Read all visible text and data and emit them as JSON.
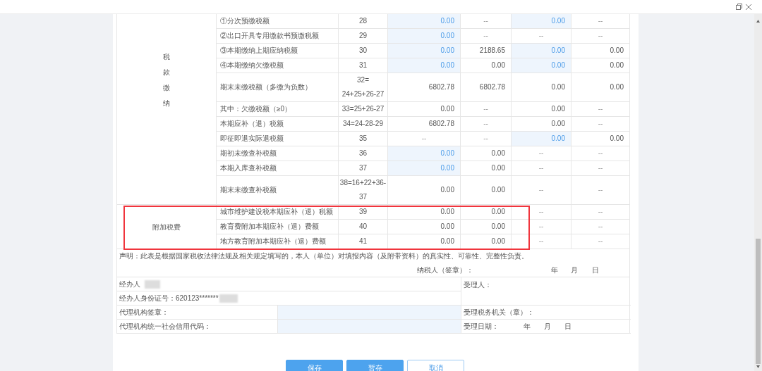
{
  "tax_payment": {
    "group": "税款缴纳",
    "rows": [
      {
        "item": "①分次预缴税额",
        "line": "28",
        "cells": [
          {
            "kind": "input",
            "text": "0.00"
          },
          {
            "kind": "blank",
            "text": "--"
          },
          {
            "kind": "input",
            "text": "0.00"
          },
          {
            "kind": "blank",
            "text": "--"
          }
        ]
      },
      {
        "item": "②出口开具专用缴款书预缴税额",
        "line": "29",
        "cells": [
          {
            "kind": "input",
            "text": "0.00"
          },
          {
            "kind": "blank",
            "text": "--"
          },
          {
            "kind": "blank",
            "text": "--"
          },
          {
            "kind": "blank",
            "text": "--"
          }
        ]
      },
      {
        "item": "③本期缴纳上期应纳税额",
        "line": "30",
        "cells": [
          {
            "kind": "input",
            "text": "0.00"
          },
          {
            "kind": "value",
            "text": "2188.65"
          },
          {
            "kind": "input",
            "text": "0.00"
          },
          {
            "kind": "value",
            "text": "0.00"
          }
        ]
      },
      {
        "item": "④本期缴纳欠缴税额",
        "line": "31",
        "cells": [
          {
            "kind": "input",
            "text": "0.00"
          },
          {
            "kind": "value",
            "text": "0.00"
          },
          {
            "kind": "input",
            "text": "0.00"
          },
          {
            "kind": "value",
            "text": "0.00"
          }
        ]
      },
      {
        "item": "期末未缴税额（多缴为负数）",
        "line": "32= 24+25+26-27",
        "cells": [
          {
            "kind": "value",
            "text": "6802.78"
          },
          {
            "kind": "value",
            "text": "6802.78"
          },
          {
            "kind": "value",
            "text": "0.00"
          },
          {
            "kind": "value",
            "text": "0.00"
          }
        ]
      },
      {
        "item": "其中：欠缴税额（≥0）",
        "line": "33=25+26-27",
        "cells": [
          {
            "kind": "value",
            "text": "0.00"
          },
          {
            "kind": "blank",
            "text": "--"
          },
          {
            "kind": "value",
            "text": "0.00"
          },
          {
            "kind": "blank",
            "text": "--"
          }
        ]
      },
      {
        "item": "本期应补（退）税额",
        "line": "34=24-28-29",
        "cells": [
          {
            "kind": "value",
            "text": "6802.78"
          },
          {
            "kind": "blank",
            "text": "--"
          },
          {
            "kind": "value",
            "text": "0.00"
          },
          {
            "kind": "blank",
            "text": "--"
          }
        ]
      },
      {
        "item": "即征即退实际退税额",
        "line": "35",
        "cells": [
          {
            "kind": "blank",
            "text": "--"
          },
          {
            "kind": "blank",
            "text": "--"
          },
          {
            "kind": "input",
            "text": "0.00"
          },
          {
            "kind": "value",
            "text": "0.00"
          }
        ]
      },
      {
        "item": "期初未缴查补税额",
        "line": "36",
        "cells": [
          {
            "kind": "input",
            "text": "0.00"
          },
          {
            "kind": "value",
            "text": "0.00"
          },
          {
            "kind": "blank",
            "text": "--"
          },
          {
            "kind": "blank",
            "text": "--"
          }
        ]
      },
      {
        "item": "本期入库查补税额",
        "line": "37",
        "cells": [
          {
            "kind": "input",
            "text": "0.00"
          },
          {
            "kind": "value",
            "text": "0.00"
          },
          {
            "kind": "blank",
            "text": "--"
          },
          {
            "kind": "blank",
            "text": "--"
          }
        ]
      },
      {
        "item": "期末未缴查补税额",
        "line": "38=16+22+36-37",
        "cells": [
          {
            "kind": "value",
            "text": "0.00"
          },
          {
            "kind": "value",
            "text": "0.00"
          },
          {
            "kind": "blank",
            "text": "--"
          },
          {
            "kind": "blank",
            "text": "--"
          }
        ]
      }
    ]
  },
  "surcharges": {
    "group": "附加税费",
    "highlighted": true,
    "rows": [
      {
        "item": "城市维护建设税本期应补（退）税额",
        "line": "39",
        "cells": [
          {
            "kind": "value",
            "text": "0.00"
          },
          {
            "kind": "value",
            "text": "0.00"
          },
          {
            "kind": "blank",
            "text": "--"
          },
          {
            "kind": "blank",
            "text": "--"
          }
        ]
      },
      {
        "item": "教育费附加本期应补（退）费额",
        "line": "40",
        "cells": [
          {
            "kind": "value",
            "text": "0.00"
          },
          {
            "kind": "value",
            "text": "0.00"
          },
          {
            "kind": "blank",
            "text": "--"
          },
          {
            "kind": "blank",
            "text": "--"
          }
        ]
      },
      {
        "item": "地方教育附加本期应补（退）费额",
        "line": "41",
        "cells": [
          {
            "kind": "value",
            "text": "0.00"
          },
          {
            "kind": "value",
            "text": "0.00"
          },
          {
            "kind": "blank",
            "text": "--"
          },
          {
            "kind": "blank",
            "text": "--"
          }
        ]
      }
    ]
  },
  "declaration": {
    "statement": "声明：此表是根据国家税收法律法规及相关规定填写的，本人（单位）对填报内容（及附带资料）的真实性、可靠性、完整性负责。",
    "signer": "纳税人（签章）：",
    "year": "年",
    "month": "月",
    "day": "日"
  },
  "signatures": {
    "agent": "经办人",
    "agent_id": "经办人身份证号：620123*******",
    "agency_seal": "代理机构签章：",
    "agency_code": "代理机构统一社会信用代码：",
    "receiver": "受理人：",
    "tax_office": "受理税务机关（章）：",
    "receive_date": "受理日期：",
    "year": "年",
    "month": "月",
    "day": "日"
  },
  "buttons": [
    {
      "label": "保存",
      "kind": "primary"
    },
    {
      "label": "暂存",
      "kind": "primary"
    },
    {
      "label": "取消",
      "kind": "secondary"
    }
  ]
}
